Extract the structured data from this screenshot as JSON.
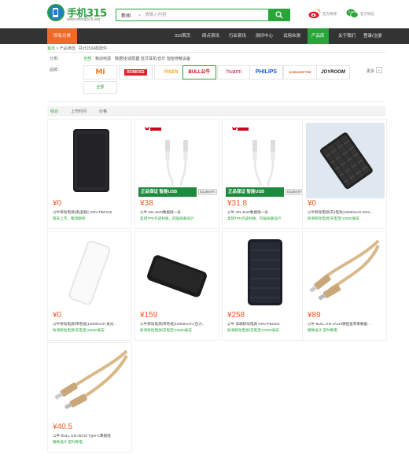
{
  "header": {
    "logo_text": "手机315",
    "logo_url": "www.shouji315.org",
    "search_category": "新闻",
    "search_placeholder": "请输入内容",
    "weibo_label": "官方微博",
    "wechat_label": "官方微信"
  },
  "nav": {
    "category_button": "所有分类",
    "items": [
      "315首页",
      "网点资讯",
      "行业资讯",
      "测评中心",
      "试用众测",
      "产品库",
      "关于我们",
      "登录/注册"
    ],
    "active_index": 5
  },
  "breadcrumb": {
    "home": "首页",
    "sep": ">",
    "section": "产品筛选",
    "count": "共计2534款配件"
  },
  "filters": {
    "category_label": "分类：",
    "categories": [
      "全部",
      "移动电源",
      "数据线/适配器",
      "蓝牙耳机/音乐",
      "智能穿戴设备"
    ],
    "category_selected": 0,
    "brand_label": "品牌：",
    "brands": [
      {
        "name": "MI",
        "color": "#f47c20"
      },
      {
        "name": "ROMOSS",
        "color": "#e21f26"
      },
      {
        "name": "PISEN",
        "color": "#f5a623"
      },
      {
        "name": "BULL公牛",
        "color": "#d0021b"
      },
      {
        "name": "huami",
        "color": "#c2185b"
      },
      {
        "name": "PHILIPS",
        "color": "#0b5ed7"
      },
      {
        "name": "SCIENCEPTRE",
        "color": "#e94e1b"
      },
      {
        "name": "JOYROOM",
        "color": "#222222"
      }
    ],
    "brand_selected": 3,
    "all_label": "全部",
    "more_label": "更多",
    "more_icon": "chevron-down-icon"
  },
  "sort": {
    "items": [
      "综合",
      "上市时间",
      "价格"
    ],
    "selected": 0
  },
  "products": [
    {
      "price": "¥0",
      "title": "公牛移动电源(黑)超极(-GNV-PBF102",
      "sub": "暂未上市，敬请期待",
      "image": "powerbank-dark",
      "badge": ""
    },
    {
      "price": "¥38",
      "title": "公牛 GN-J610数据线一米",
      "sub": "柔韧TPE外皮材质，四层屏蔽设计",
      "image": "cable-white",
      "badge": "正品保证 智能USB",
      "badge_side": "原装通用配件"
    },
    {
      "price": "¥31.8",
      "title": "公牛 GN-J510数据线一米",
      "sub": "柔韧TPE外皮材质，四层屏蔽设计",
      "image": "cable-white",
      "badge": "正品保证 智能USB",
      "badge_side": "原装通用配件"
    },
    {
      "price": "¥0",
      "title": "公牛移动电源(灰)电池(10000mAh-GNV...",
      "sub": "防滑移动电源/充电宝/10000毫安",
      "image": "powerbank-gray",
      "badge": ""
    },
    {
      "price": "¥0",
      "title": "公牛移动电源(带卷纸)10000mAh-发光...",
      "sub": "防滑移动电源/充电宝/10000毫安",
      "image": "powerbank-white",
      "badge": ""
    },
    {
      "price": "¥159",
      "title": "公牛移动电源(带卷纸)10000mAh-(合力...",
      "sub": "防滑移动电源/充电宝/10000毫安",
      "image": "powerbank-slim",
      "badge": ""
    },
    {
      "price": "¥258",
      "title": "公牛 高端移动电源 GNV-PB1102",
      "sub": "防滑移动电源/充电宝/10000毫安",
      "image": "powerbank-tall",
      "badge": ""
    },
    {
      "price": "¥89",
      "title": "公牛 BULL GN-J7210镀铝金苹果数据...",
      "sub": "精致设计 定时断电",
      "image": "cable-gold-lightning",
      "badge": ""
    },
    {
      "price": "¥40.5",
      "title": "公牛 BULL GN-J6210 Type-C数据线",
      "sub": "精致设计 定时断电",
      "image": "cable-gold-typec",
      "badge": ""
    }
  ],
  "colors": {
    "accent": "#2aa53a",
    "nav_bg": "#333333",
    "category_btn": "#f0692b",
    "price": "#f05a28"
  }
}
